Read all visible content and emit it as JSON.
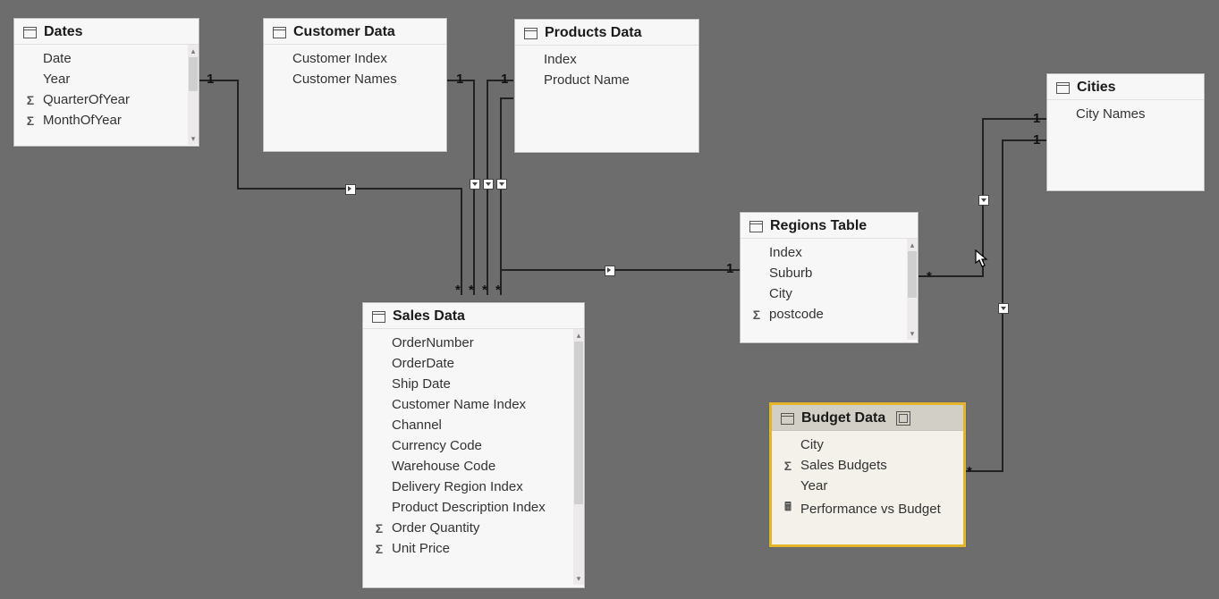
{
  "tables": {
    "dates": {
      "title": "Dates",
      "fields": [
        "Date",
        "Year",
        "QuarterOfYear",
        "MonthOfYear"
      ],
      "sigma_idx": [
        2,
        3
      ]
    },
    "customer": {
      "title": "Customer Data",
      "fields": [
        "Customer Index",
        "Customer Names"
      ]
    },
    "products": {
      "title": "Products Data",
      "fields": [
        "Index",
        "Product Name"
      ]
    },
    "regions": {
      "title": "Regions Table",
      "fields": [
        "Index",
        "Suburb",
        "City",
        "postcode"
      ],
      "sigma_idx": [
        3
      ]
    },
    "cities": {
      "title": "Cities",
      "fields": [
        "City Names"
      ]
    },
    "sales": {
      "title": "Sales Data",
      "fields": [
        "OrderNumber",
        "OrderDate",
        "Ship Date",
        "Customer Name Index",
        "Channel",
        "Currency Code",
        "Warehouse Code",
        "Delivery Region Index",
        "Product Description Index",
        "Order Quantity",
        "Unit Price"
      ],
      "sigma_idx": [
        9,
        10
      ]
    },
    "budget": {
      "title": "Budget Data",
      "fields": [
        "City",
        "Sales Budgets",
        "Year",
        "Performance vs Budget"
      ],
      "sigma_idx": [
        1
      ],
      "calc_idx": [
        3
      ]
    }
  },
  "cardinality": {
    "one": "1",
    "many": "*"
  },
  "scroll": {
    "up": "▴",
    "down": "▾"
  }
}
